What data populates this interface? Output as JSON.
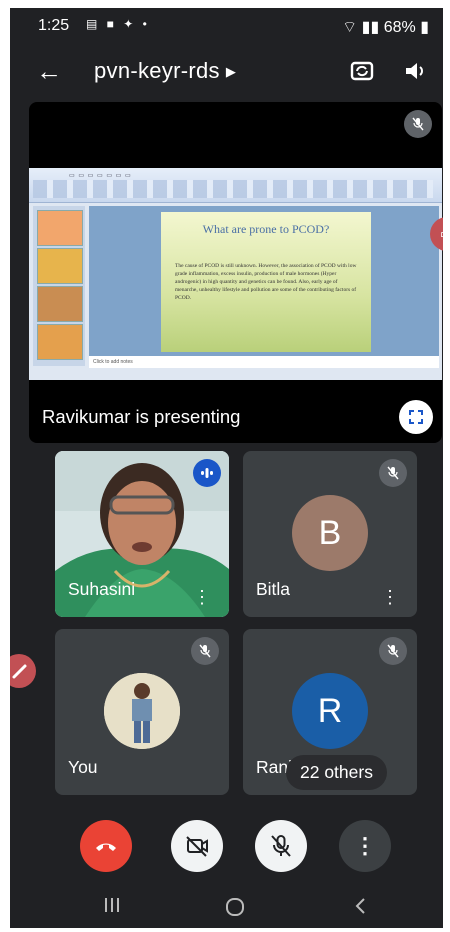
{
  "status_bar": {
    "time": "1:25",
    "icons": [
      "notification-icon",
      "video-icon",
      "app-icon",
      "dot"
    ],
    "battery": "68%"
  },
  "top_bar": {
    "meeting_code": "pvn-keyr-rds"
  },
  "presentation": {
    "slide_title": "What are prone to PCOD?",
    "slide_body": "The cause of PCOD is still unknown. However, the association of PCOD with low grade inflammation, excess insulin, production of male hormones (Hyper androgenic) in high quantity and genetics can be found. Also, early age of menarche, unhealthy lifestyle and pollution are some of the contributing factors of PCOD.",
    "notes_placeholder": "Click to add notes",
    "presenter_label": "Ravikumar is presenting"
  },
  "participants": [
    {
      "name": "Suhasini",
      "type": "video",
      "state": "speaking"
    },
    {
      "name": "Bitla",
      "type": "initial",
      "initial": "B",
      "avatar_color": "#9c7a6a",
      "state": "muted"
    },
    {
      "name": "You",
      "type": "photo",
      "state": "muted"
    },
    {
      "name": "Ranjit",
      "type": "initial",
      "initial": "R",
      "avatar_color": "#1a5ea7",
      "state": "muted"
    }
  ],
  "others_count": "22 others",
  "colors": {
    "end_call": "#ea4335",
    "background": "#202124",
    "tile": "#3c4043",
    "speaking_badge": "#1a56c8",
    "side_button": "#c25054"
  }
}
